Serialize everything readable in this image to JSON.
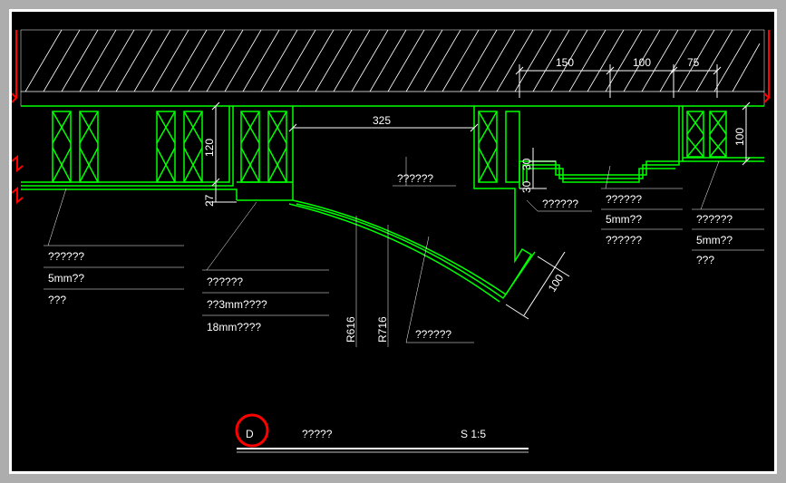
{
  "title": {
    "letter": "D",
    "text": "?????",
    "scale": "S 1:5"
  },
  "dims": {
    "d150": "150",
    "d100a": "100",
    "d75": "75",
    "d325": "325",
    "d120": "120",
    "d27": "27",
    "d30a": "30",
    "d30b": "30",
    "d100b": "100",
    "d100c": "100",
    "r616": "R616",
    "r716": "R716"
  },
  "labels": {
    "l1": "??????",
    "l2": "5mm??",
    "l3": "???",
    "l4": "??????",
    "l5": "??3mm????",
    "l6": "18mm????",
    "l7": "??????",
    "l8": "??????",
    "l9": "??????",
    "l10": "??????",
    "l11": "5mm??",
    "l12": "??????",
    "l13": "??????",
    "l14": "5mm??",
    "l15": "???"
  }
}
